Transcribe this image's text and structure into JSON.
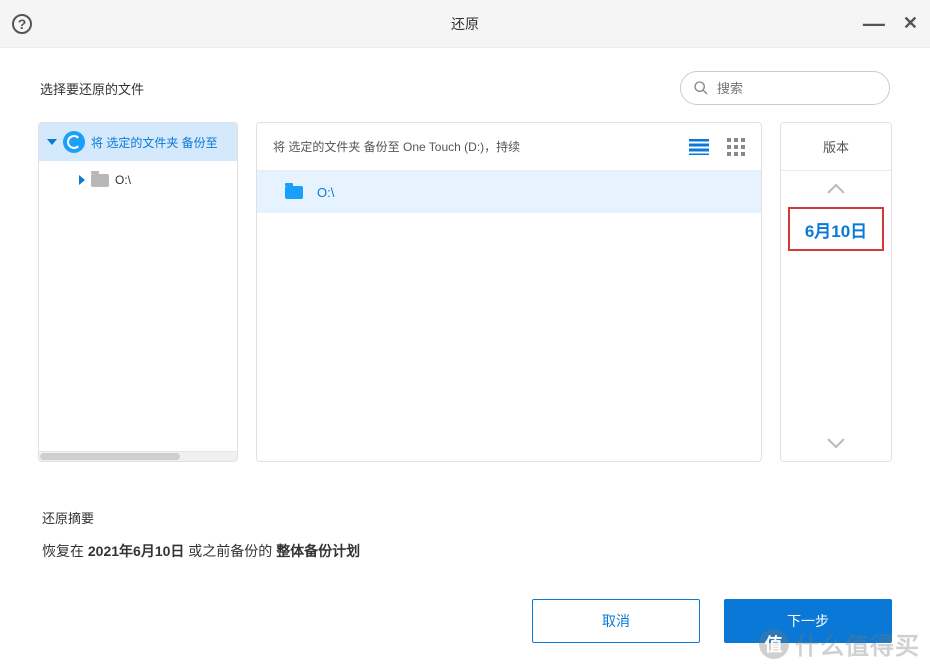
{
  "window": {
    "title": "还原"
  },
  "header": {
    "select_label": "选择要还原的文件",
    "search_placeholder": "搜索"
  },
  "tree": {
    "items": [
      {
        "label": "将 选定的文件夹 备份至"
      },
      {
        "label": "O:\\"
      }
    ]
  },
  "list": {
    "breadcrumb": "将 选定的文件夹 备份至 One Touch (D:)，持续",
    "rows": [
      {
        "label": "O:\\"
      }
    ]
  },
  "versions": {
    "title": "版本",
    "items": [
      "6月10日"
    ]
  },
  "summary": {
    "title": "还原摘要",
    "prefix": "恢复在 ",
    "date": "2021年6月10日",
    "middle": " 或之前备份的 ",
    "plan": "整体备份计划"
  },
  "footer": {
    "cancel": "取消",
    "next": "下一步"
  },
  "watermark": "什么值得买"
}
